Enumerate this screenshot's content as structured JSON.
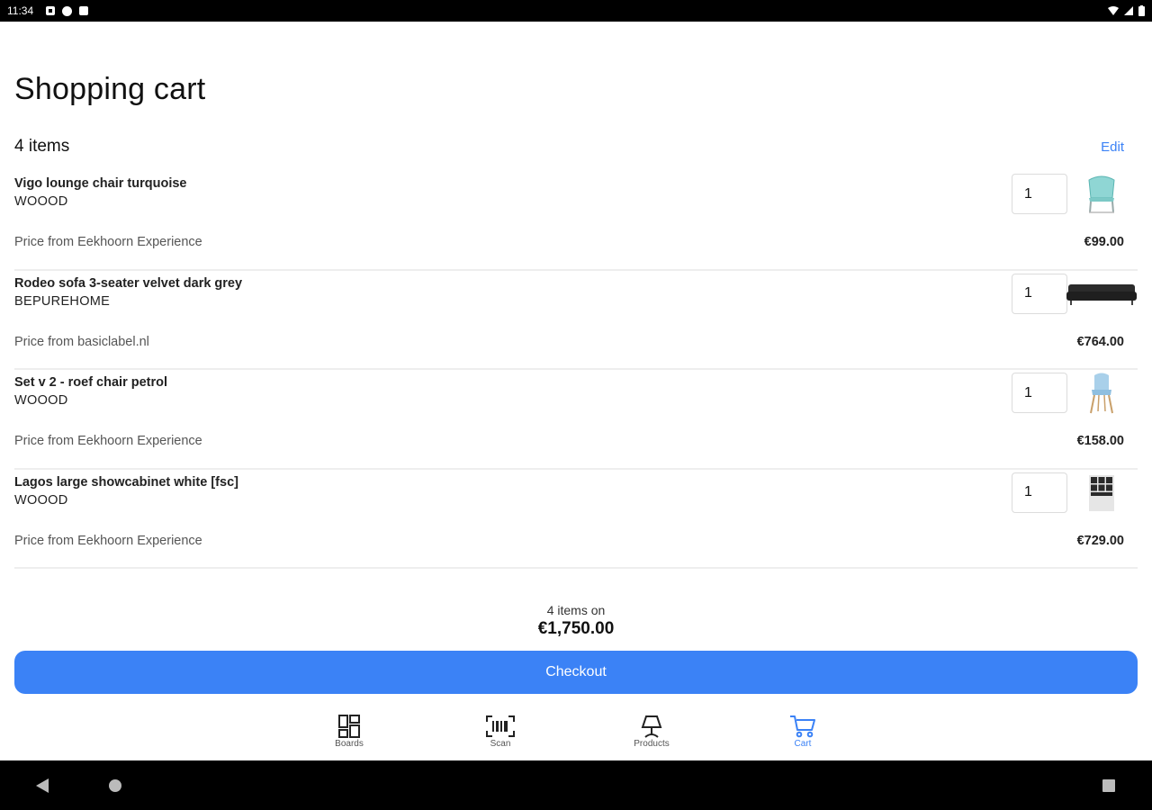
{
  "status_bar": {
    "time": "11:34"
  },
  "page": {
    "title": "Shopping cart"
  },
  "cart": {
    "count_label": "4 items",
    "edit_label": "Edit",
    "items": [
      {
        "name": "Vigo lounge chair turquoise",
        "brand": "WOOOD",
        "source": "Price from Eekhoorn Experience",
        "price": "€99.00",
        "qty": "1",
        "thumb_icon": "lounge-chair-thumbnail"
      },
      {
        "name": "Rodeo sofa 3-seater velvet dark grey",
        "brand": "BEPUREHOME",
        "source": "Price from basiclabel.nl",
        "price": "€764.00",
        "qty": "1",
        "thumb_icon": "sofa-thumbnail"
      },
      {
        "name": "Set v 2 - roef chair petrol",
        "brand": "WOOOD",
        "source": "Price from Eekhoorn Experience",
        "price": "€158.00",
        "qty": "1",
        "thumb_icon": "chair-thumbnail"
      },
      {
        "name": "Lagos large showcabinet white [fsc]",
        "brand": "WOOOD",
        "source": "Price from Eekhoorn Experience",
        "price": "€729.00",
        "qty": "1",
        "thumb_icon": "cabinet-thumbnail"
      }
    ]
  },
  "summary": {
    "label": "4 items on",
    "total": "€1,750.00"
  },
  "checkout": {
    "label": "Checkout"
  },
  "nav": {
    "items": [
      {
        "label": "Boards",
        "icon": "boards-icon",
        "active": false
      },
      {
        "label": "Scan",
        "icon": "barcode-scan-icon",
        "active": false
      },
      {
        "label": "Products",
        "icon": "lamp-icon",
        "active": false
      },
      {
        "label": "Cart",
        "icon": "cart-icon",
        "active": true
      }
    ]
  },
  "colors": {
    "accent": "#3b82f6",
    "divider": "#eeeeee",
    "text": "#222222"
  }
}
